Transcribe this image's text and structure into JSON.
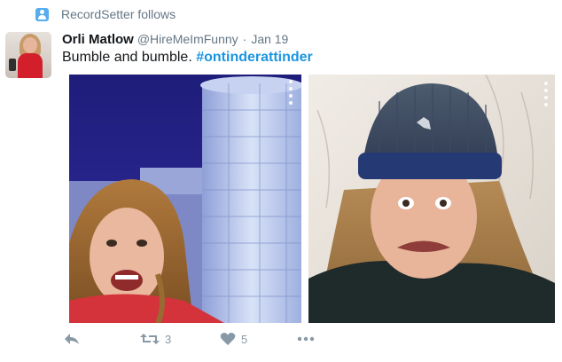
{
  "context": {
    "label": "RecordSetter follows",
    "icon": "person-icon"
  },
  "tweet": {
    "author_name": "Orli Matlow",
    "handle": "@HireMeImFunny",
    "separator": "·",
    "date": "Jan 19",
    "text_plain": "Bumble and bumble.",
    "hashtag": "#ontinderattinder",
    "retweet_count": "3",
    "like_count": "5"
  },
  "media": [
    {
      "description": "icon-night-selfie-photo"
    },
    {
      "description": "icon-beanie-selfie-photo"
    }
  ],
  "colors": {
    "hashtag": "#1b95e0",
    "context_icon": "#55acee",
    "muted": "#8899a6"
  }
}
